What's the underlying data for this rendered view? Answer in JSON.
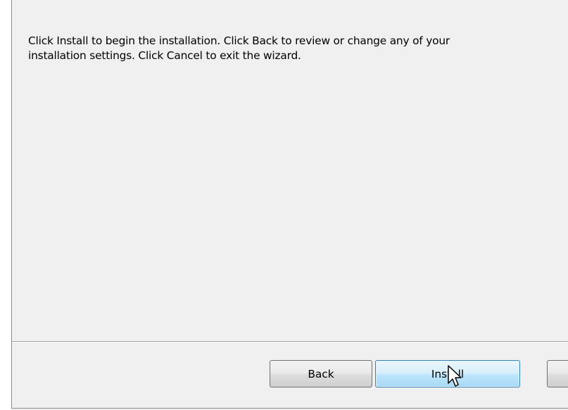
{
  "dialog": {
    "message_line1": "Click Install to begin the installation. Click Back to review or change any of your",
    "message_line2": "installation settings. Click Cancel to exit the wizard."
  },
  "buttons": {
    "back_label": "Back",
    "install_label": "Install",
    "cancel_label": ""
  },
  "icons": {
    "cursor": "arrow-cursor-icon"
  },
  "colors": {
    "window_bg": "#f0f0f0",
    "focused_button_border": "#3c7fb1",
    "focused_button_fill": "#bee6fd"
  }
}
